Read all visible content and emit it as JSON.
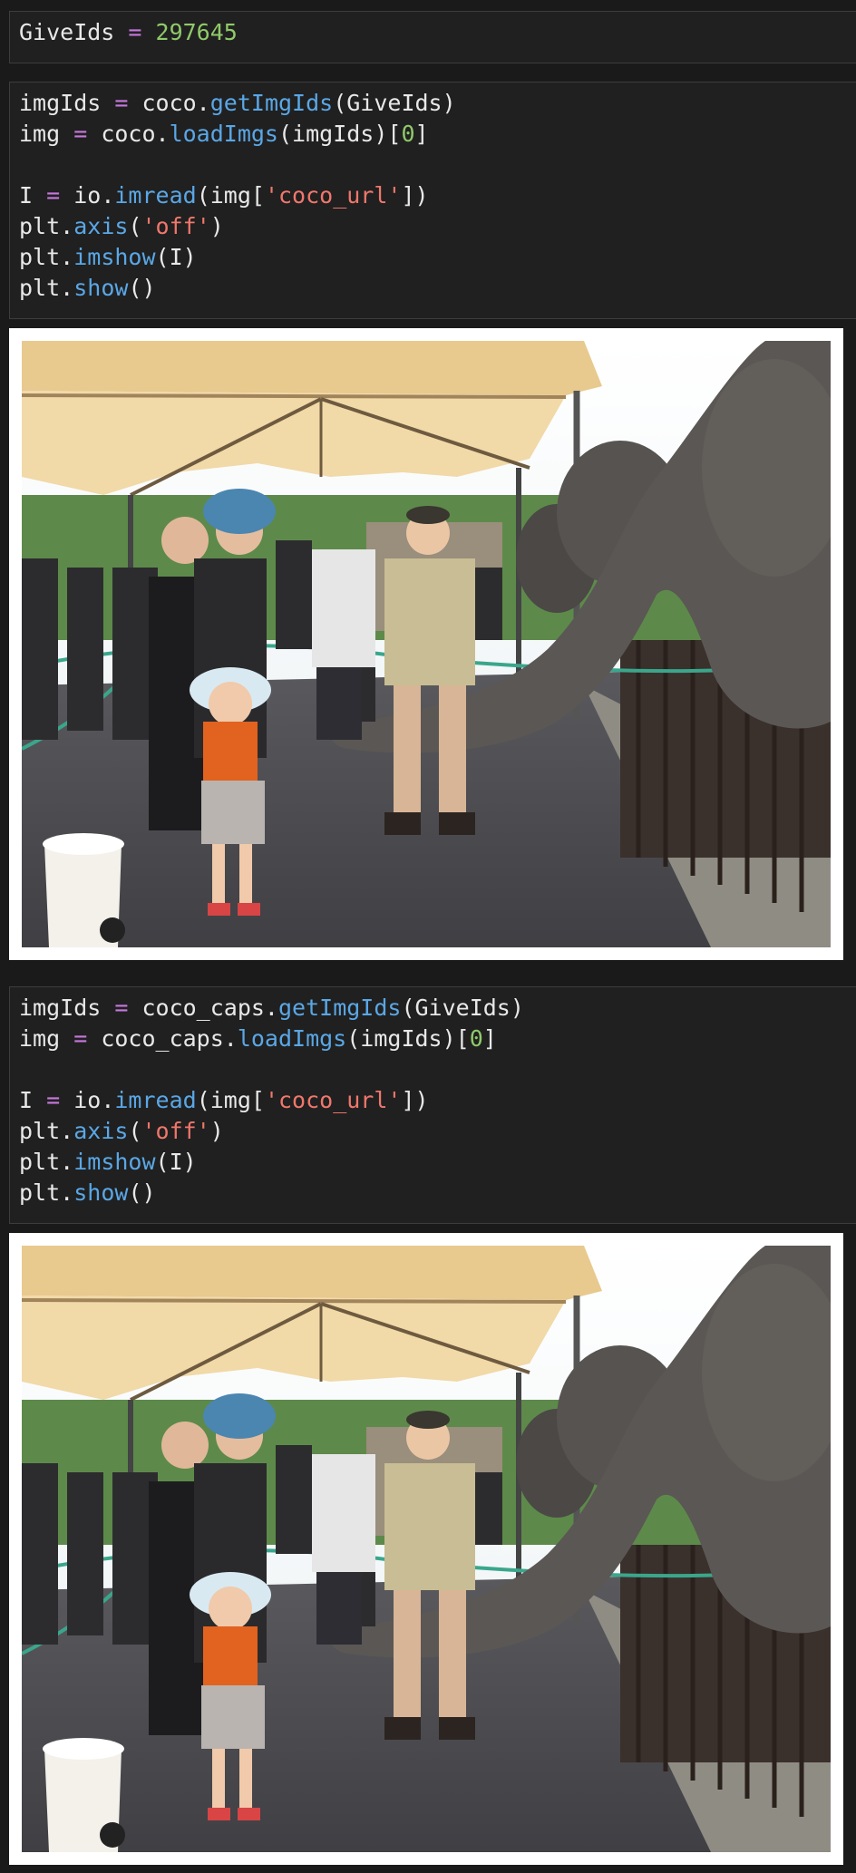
{
  "cells": [
    {
      "lines": [
        [
          {
            "t": "GiveIds",
            "c": ""
          },
          {
            "t": " = ",
            "c": "kw"
          },
          {
            "t": "297645",
            "c": "num"
          }
        ]
      ]
    },
    {
      "lines": [
        [
          {
            "t": "imgIds",
            "c": ""
          },
          {
            "t": " = ",
            "c": "kw"
          },
          {
            "t": "coco.",
            "c": ""
          },
          {
            "t": "getImgIds",
            "c": "fn"
          },
          {
            "t": "(GiveIds)",
            "c": ""
          }
        ],
        [
          {
            "t": "img",
            "c": ""
          },
          {
            "t": " = ",
            "c": "kw"
          },
          {
            "t": "coco.",
            "c": ""
          },
          {
            "t": "loadImgs",
            "c": "fn"
          },
          {
            "t": "(imgIds)[",
            "c": ""
          },
          {
            "t": "0",
            "c": "num"
          },
          {
            "t": "]",
            "c": ""
          }
        ],
        [],
        [
          {
            "t": "I",
            "c": ""
          },
          {
            "t": " = ",
            "c": "kw"
          },
          {
            "t": "io.",
            "c": ""
          },
          {
            "t": "imread",
            "c": "fn"
          },
          {
            "t": "(img[",
            "c": ""
          },
          {
            "t": "'coco_url'",
            "c": "str"
          },
          {
            "t": "])",
            "c": ""
          }
        ],
        [
          {
            "t": "plt.",
            "c": ""
          },
          {
            "t": "axis",
            "c": "fn"
          },
          {
            "t": "(",
            "c": ""
          },
          {
            "t": "'off'",
            "c": "str"
          },
          {
            "t": ")",
            "c": ""
          }
        ],
        [
          {
            "t": "plt.",
            "c": ""
          },
          {
            "t": "imshow",
            "c": "fn"
          },
          {
            "t": "(I)",
            "c": ""
          }
        ],
        [
          {
            "t": "plt.",
            "c": ""
          },
          {
            "t": "show",
            "c": "fn"
          },
          {
            "t": "()",
            "c": ""
          }
        ]
      ]
    },
    {
      "lines": [
        [
          {
            "t": "imgIds",
            "c": ""
          },
          {
            "t": " = ",
            "c": "kw"
          },
          {
            "t": "coco_caps.",
            "c": ""
          },
          {
            "t": "getImgIds",
            "c": "fn"
          },
          {
            "t": "(GiveIds)",
            "c": ""
          }
        ],
        [
          {
            "t": "img",
            "c": ""
          },
          {
            "t": " = ",
            "c": "kw"
          },
          {
            "t": "coco_caps.",
            "c": ""
          },
          {
            "t": "loadImgs",
            "c": "fn"
          },
          {
            "t": "(imgIds)[",
            "c": ""
          },
          {
            "t": "0",
            "c": "num"
          },
          {
            "t": "]",
            "c": ""
          }
        ],
        [],
        [
          {
            "t": "I",
            "c": ""
          },
          {
            "t": " = ",
            "c": "kw"
          },
          {
            "t": "io.",
            "c": ""
          },
          {
            "t": "imread",
            "c": "fn"
          },
          {
            "t": "(img[",
            "c": ""
          },
          {
            "t": "'coco_url'",
            "c": "str"
          },
          {
            "t": "])",
            "c": ""
          }
        ],
        [
          {
            "t": "plt.",
            "c": ""
          },
          {
            "t": "axis",
            "c": "fn"
          },
          {
            "t": "(",
            "c": ""
          },
          {
            "t": "'off'",
            "c": "str"
          },
          {
            "t": ")",
            "c": ""
          }
        ],
        [
          {
            "t": "plt.",
            "c": ""
          },
          {
            "t": "imshow",
            "c": "fn"
          },
          {
            "t": "(I)",
            "c": ""
          }
        ],
        [
          {
            "t": "plt.",
            "c": ""
          },
          {
            "t": "show",
            "c": "fn"
          },
          {
            "t": "()",
            "c": ""
          }
        ]
      ]
    }
  ],
  "outputs": [
    {
      "image": "elephant-feeding-photo"
    },
    {
      "image": "elephant-feeding-photo"
    }
  ]
}
